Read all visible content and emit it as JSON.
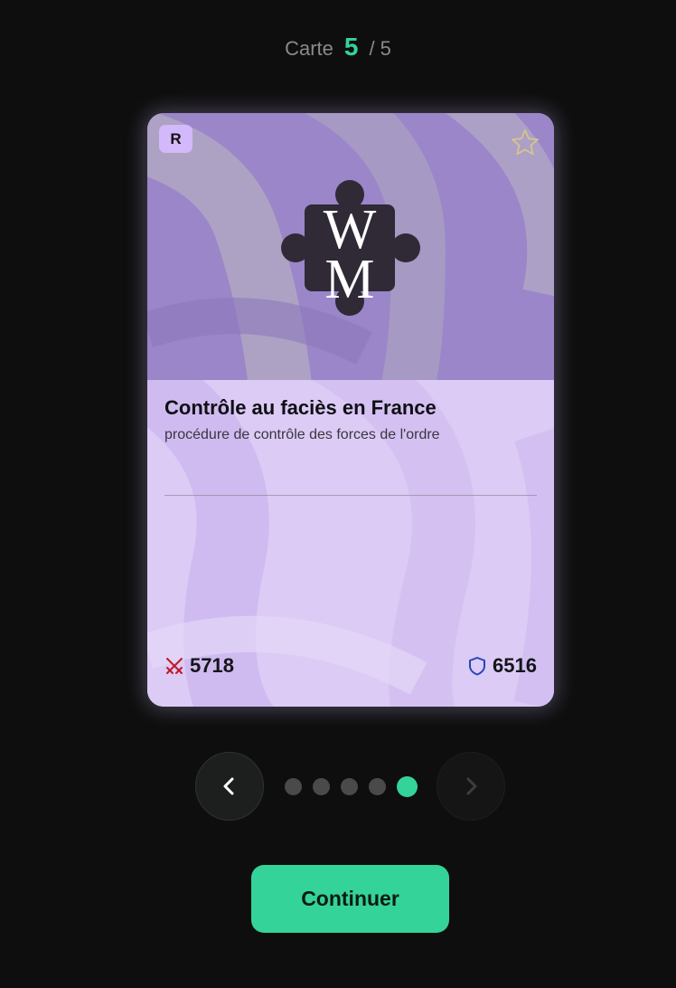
{
  "counter": {
    "label": "Carte",
    "current": "5",
    "total": "/ 5"
  },
  "card": {
    "rarity": "R",
    "title": "Contrôle au faciès en France",
    "subtitle": "procédure de contrôle des forces de l'ordre",
    "attack": "5718",
    "defense": "6516",
    "logo_letters": {
      "top": "W",
      "bottom": "M"
    },
    "favorited": false
  },
  "pagination": {
    "total": 5,
    "active_index": 4
  },
  "actions": {
    "continue_label": "Continuer"
  },
  "colors": {
    "accent": "#34d399",
    "card_art": "#9b86c8",
    "card_body": "#ddccf4",
    "attack_icon": "#c0182a",
    "defense_icon": "#2346b8"
  },
  "icons": {
    "favorite": "star-outline-icon",
    "attack": "crossed-swords-icon",
    "defense": "shield-icon",
    "prev": "chevron-left-icon",
    "next": "chevron-right-icon",
    "logo": "puzzle-piece-icon"
  }
}
